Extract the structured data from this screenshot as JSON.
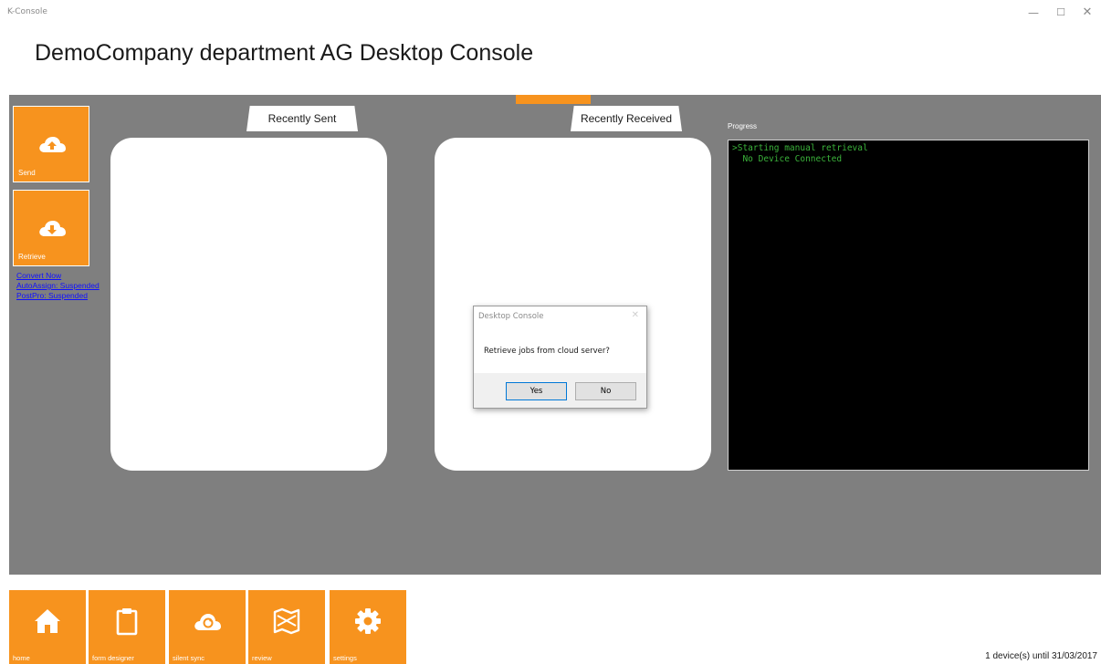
{
  "window": {
    "title": "K-Console",
    "minimize_glyph": "—",
    "maximize_glyph": "☐",
    "close_glyph": "✕"
  },
  "header": {
    "title": "DemoCompany department AG Desktop Console"
  },
  "side_tiles": {
    "send": {
      "label": "Send",
      "icon": "cloud-upload-icon"
    },
    "retrieve": {
      "label": "Retrieve",
      "icon": "cloud-download-icon"
    }
  },
  "side_links": {
    "convert_now": "Convert Now",
    "auto_assign": "AutoAssign: Suspended",
    "post_pro": "PostPro: Suspended"
  },
  "panels": {
    "sent_title": "Recently Sent",
    "received_title": "Recently Received"
  },
  "progress": {
    "label": "Progress",
    "log": ">Starting manual retrieval\n  No Device Connected"
  },
  "dialog": {
    "title": "Desktop Console",
    "close_glyph": "✕",
    "message": "Retrieve jobs from cloud server?",
    "yes_label": "Yes",
    "no_label": "No"
  },
  "bottom_nav": {
    "home": {
      "label": "home",
      "icon": "home-icon"
    },
    "form_designer": {
      "label": "form designer",
      "icon": "clipboard-icon"
    },
    "silent_sync": {
      "label": "silent sync",
      "icon": "cloud-sync-icon"
    },
    "review": {
      "label": "review",
      "icon": "map-icon"
    },
    "settings": {
      "label": "settings",
      "icon": "gear-icon"
    }
  },
  "status": {
    "license": "1 device(s) until 31/03/2017"
  },
  "colors": {
    "accent": "#f7931e",
    "main_background": "#7f7f7f",
    "console_text": "#3bb33b",
    "link": "#1010ff"
  }
}
